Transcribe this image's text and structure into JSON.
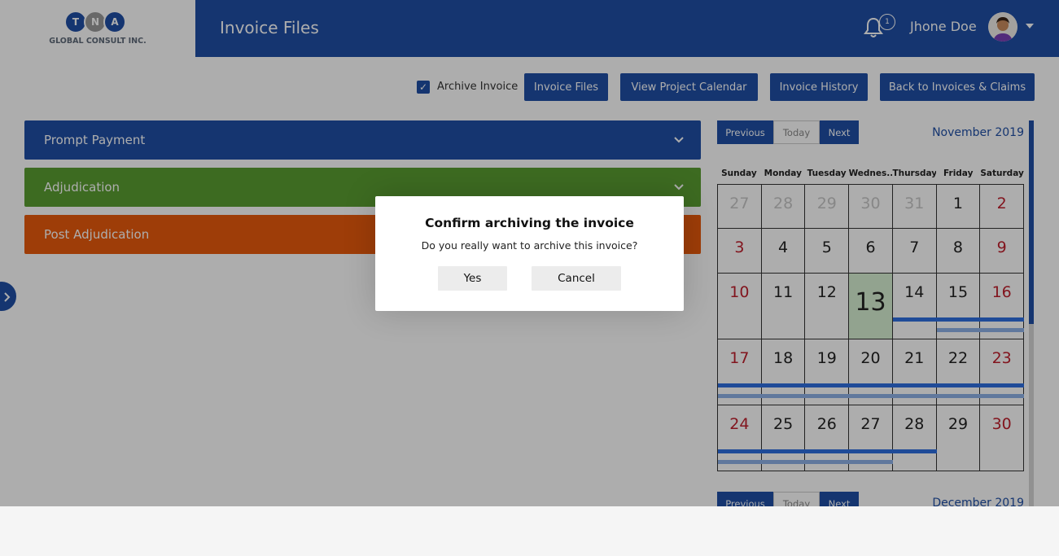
{
  "brand": {
    "letters": [
      "T",
      "N",
      "A"
    ],
    "name": "GLOBAL CONSULT INC."
  },
  "header": {
    "title": "Invoice Files",
    "notifications_count": "1",
    "user_name": "Jhone Doe"
  },
  "toolbar": {
    "archive_label": "Archive Invoice",
    "archive_checked": true,
    "buttons": [
      "Invoice Files",
      "View Project Calendar",
      "Invoice History",
      "Back to Invoices & Claims"
    ]
  },
  "sections": [
    "Prompt Payment",
    "Adjudication",
    "Post Adjudication"
  ],
  "calendar": {
    "nav": {
      "prev": "Previous",
      "today": "Today",
      "next": "Next"
    },
    "month": "November 2019",
    "next_month": "December 2019",
    "weekdays": [
      "Sunday",
      "Monday",
      "Tuesday",
      "Wednes...",
      "Thursday",
      "Friday",
      "Saturday"
    ],
    "weeks": [
      [
        "27",
        "28",
        "29",
        "30",
        "31",
        "1",
        "2"
      ],
      [
        "3",
        "4",
        "5",
        "6",
        "7",
        "8",
        "9"
      ],
      [
        "10",
        "11",
        "12",
        "13",
        "14",
        "15",
        "16"
      ],
      [
        "17",
        "18",
        "19",
        "20",
        "21",
        "22",
        "23"
      ],
      [
        "24",
        "25",
        "26",
        "27",
        "28",
        "29",
        "30"
      ]
    ],
    "today": "13"
  },
  "modal": {
    "title": "Confirm archiving the invoice",
    "message": "Do you really want to archive this invoice?",
    "yes": "Yes",
    "cancel": "Cancel"
  },
  "colors": {
    "primary": "#1f4fa6",
    "green": "#5a9e32",
    "orange": "#e95a0c",
    "weekend": "#c0202d"
  }
}
